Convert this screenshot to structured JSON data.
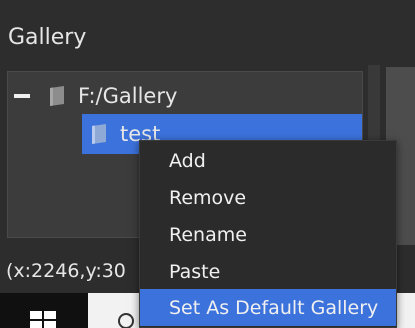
{
  "panel": {
    "title": "Gallery"
  },
  "tree": {
    "root": {
      "label": "F:/Gallery",
      "icon": "folder-icon",
      "expanded": true
    },
    "children": [
      {
        "label": "test",
        "icon": "folder-icon",
        "selected": true
      }
    ]
  },
  "status": {
    "coords": "(x:2246,y:30"
  },
  "context_menu": {
    "items": [
      {
        "label": "Add"
      },
      {
        "label": "Remove"
      },
      {
        "label": "Rename"
      },
      {
        "label": "Paste"
      },
      {
        "label": "Set As Default Gallery",
        "highlighted": true
      }
    ]
  },
  "taskbar": {
    "start_icon": "windows-icon",
    "search_icon": "search-icon"
  },
  "colors": {
    "background": "#2d2d2d",
    "tree_bg": "#3c3c3c",
    "selection": "#3c72dc",
    "menu_bg": "#2b2b2b",
    "text": "#e6e6e6",
    "taskbar": "#101010"
  }
}
